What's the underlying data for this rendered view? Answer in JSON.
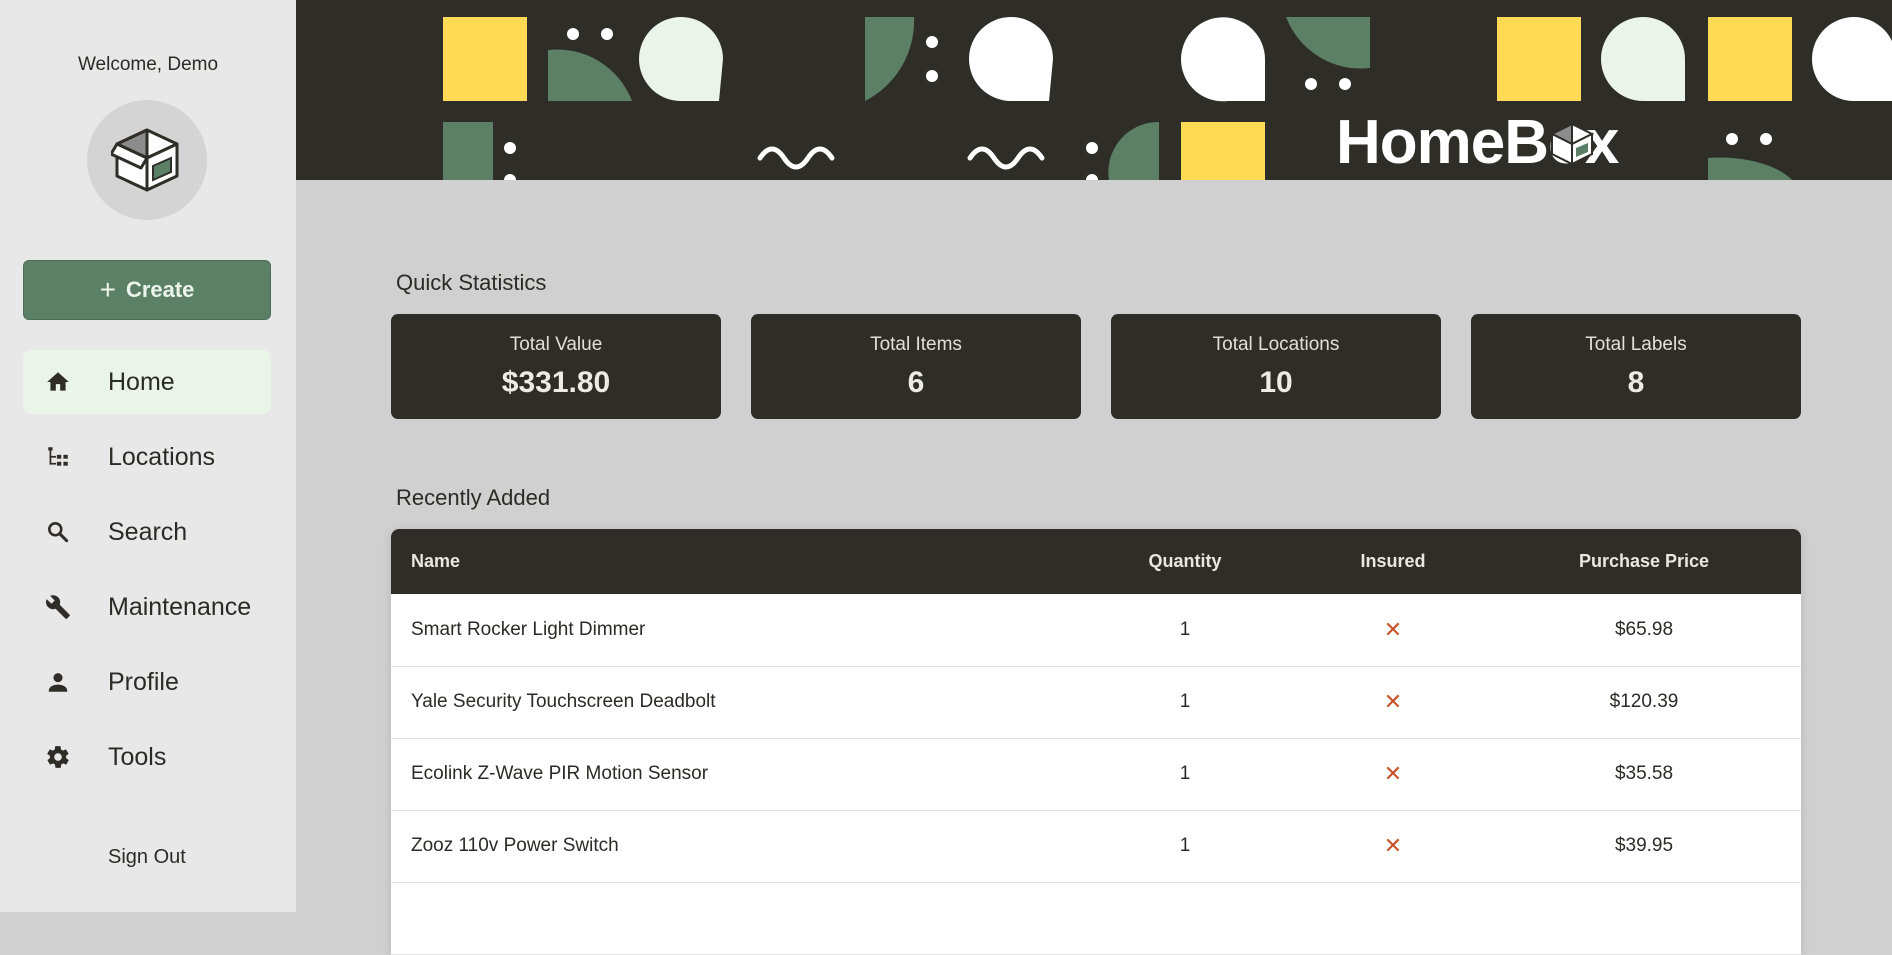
{
  "sidebar": {
    "welcome": "Welcome, Demo",
    "create_label": "Create",
    "nav": [
      {
        "label": "Home",
        "icon": "home-icon",
        "active": true
      },
      {
        "label": "Locations",
        "icon": "tree-icon"
      },
      {
        "label": "Search",
        "icon": "search-icon"
      },
      {
        "label": "Maintenance",
        "icon": "wrench-icon"
      },
      {
        "label": "Profile",
        "icon": "person-icon"
      },
      {
        "label": "Tools",
        "icon": "gear-icon"
      }
    ],
    "signout_label": "Sign Out"
  },
  "header": {
    "brand": "HomeBox"
  },
  "stats": {
    "title": "Quick Statistics",
    "cards": [
      {
        "label": "Total Value",
        "value": "$331.80"
      },
      {
        "label": "Total Items",
        "value": "6"
      },
      {
        "label": "Total Locations",
        "value": "10"
      },
      {
        "label": "Total Labels",
        "value": "8"
      }
    ]
  },
  "recent": {
    "title": "Recently Added",
    "columns": [
      "Name",
      "Quantity",
      "Insured",
      "Purchase Price"
    ],
    "rows": [
      {
        "name": "Smart Rocker Light Dimmer",
        "quantity": "1",
        "insured": "✕",
        "price": "$65.98"
      },
      {
        "name": "Yale Security Touchscreen Deadbolt",
        "quantity": "1",
        "insured": "✕",
        "price": "$120.39"
      },
      {
        "name": "Ecolink Z-Wave PIR Motion Sensor",
        "quantity": "1",
        "insured": "✕",
        "price": "$35.58"
      },
      {
        "name": "Zooz 110v Power Switch",
        "quantity": "1",
        "insured": "✕",
        "price": "$39.95"
      }
    ]
  },
  "colors": {
    "dark": "#2e2d27",
    "accent_green": "#5b8065",
    "yellow": "#ffda55",
    "light_green": "#eaf4e8",
    "cross": "#c8552b"
  }
}
